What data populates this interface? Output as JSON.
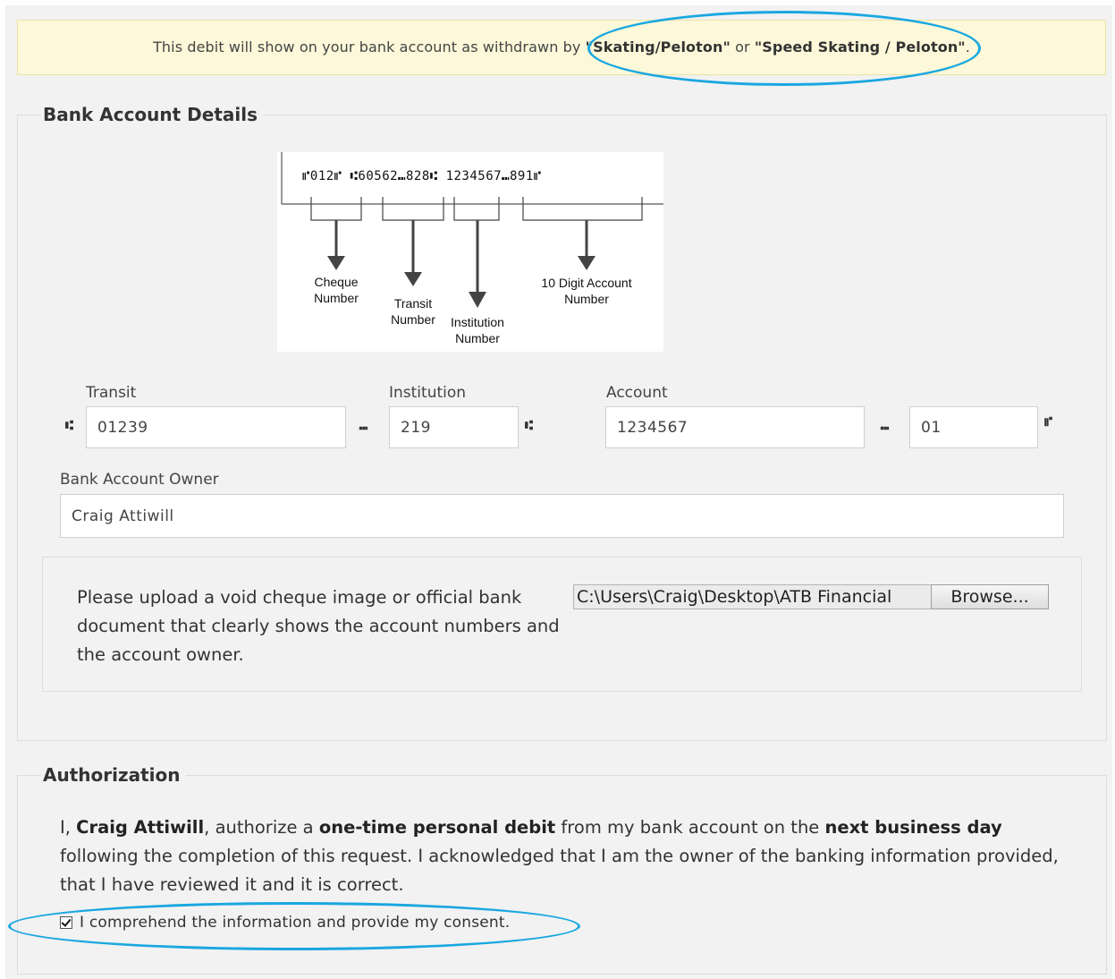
{
  "notice": {
    "prefix": "This debit will show on your bank account as withdrawn by ",
    "name1": "\"Skating/Peloton\"",
    "middle": " or ",
    "name2": "\"Speed Skating / Peloton\"",
    "suffix": "."
  },
  "bank_details": {
    "legend": "Bank Account Details",
    "cheque_diagram": {
      "micr": "⑈012⑈ ⑆60562⑉828⑆ 1234567⑉891⑈",
      "labels": {
        "cheque_number": [
          "Cheque",
          "Number"
        ],
        "transit_number": [
          "Transit",
          "Number"
        ],
        "institution_number": [
          "Institution",
          "Number"
        ],
        "account_number": [
          "10 Digit Account",
          "Number"
        ]
      }
    },
    "transit": {
      "label": "Transit",
      "value": "01239"
    },
    "institution": {
      "label": "Institution",
      "value": "219"
    },
    "account": {
      "label": "Account",
      "value": "1234567",
      "suffix_value": "01"
    },
    "micr_symbols": {
      "transit": "⑆",
      "dash": "⑉",
      "on_us": "⑈"
    },
    "owner": {
      "label": "Bank Account Owner",
      "value": "Craig Attiwill"
    },
    "upload": {
      "text": "Please upload a void cheque image or official bank document that clearly shows the account numbers and the account owner.",
      "file_path": "C:\\Users\\Craig\\Desktop\\ATB Financial",
      "browse_label": "Browse..."
    }
  },
  "authorization": {
    "legend": "Authorization",
    "text": {
      "p1": "I, ",
      "name": "Craig Attiwill",
      "p2": ", authorize a ",
      "debit_type": "one-time personal debit",
      "p3": " from my bank account on the ",
      "timing": "next business day",
      "p4": " following the completion of this request. I acknowledged that I am the owner of the banking information provided, that I have reviewed it and it is correct."
    },
    "consent_label": "I comprehend the information and provide my consent.",
    "consent_checked": true
  },
  "colors": {
    "annotation": "#1aa7e0",
    "notice_bg": "#fcf8d9",
    "page_bg": "#f2f2f2"
  }
}
